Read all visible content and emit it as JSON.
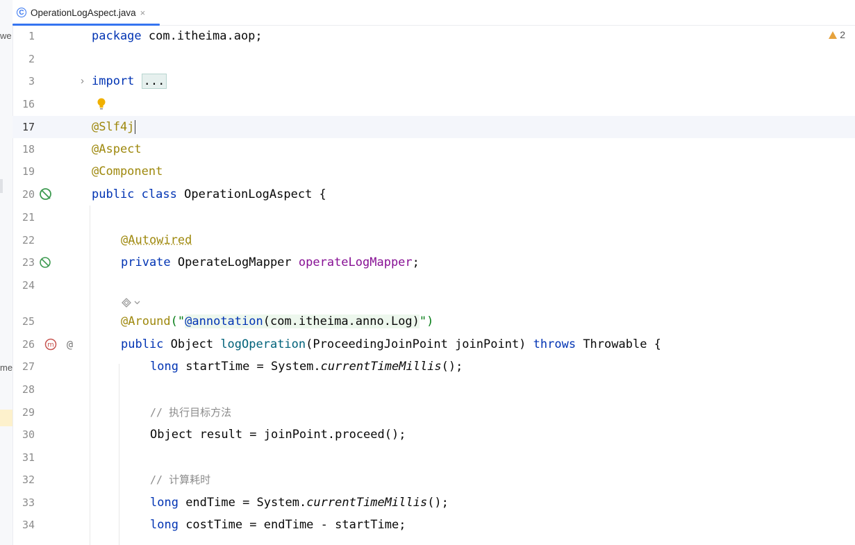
{
  "tab": {
    "title": "OperationLogAspect.java",
    "close": "×",
    "icon_letter": "C",
    "accent": "#3574f0"
  },
  "warnings": {
    "count": "2"
  },
  "left_strip": {
    "text1": "we",
    "text2": "me"
  },
  "lines": [
    {
      "n": "1",
      "code": "package com.itheima.aop;"
    },
    {
      "n": "2",
      "code": ""
    },
    {
      "n": "3",
      "code": "import ..."
    },
    {
      "n": "16",
      "code": ""
    },
    {
      "n": "17",
      "code": "@Slf4j"
    },
    {
      "n": "18",
      "code": "@Aspect"
    },
    {
      "n": "19",
      "code": "@Component"
    },
    {
      "n": "20",
      "code": "public class OperationLogAspect {"
    },
    {
      "n": "21",
      "code": ""
    },
    {
      "n": "22",
      "code": "@Autowired"
    },
    {
      "n": "23",
      "code": "private OperateLogMapper operateLogMapper;"
    },
    {
      "n": "24",
      "code": ""
    },
    {
      "n": "25",
      "code": "@Around(\"@annotation(com.itheima.anno.Log)\")"
    },
    {
      "n": "26",
      "code": "public Object logOperation(ProceedingJoinPoint joinPoint) throws Throwable {"
    },
    {
      "n": "27",
      "code": "long startTime = System.currentTimeMillis();"
    },
    {
      "n": "28",
      "code": ""
    },
    {
      "n": "29",
      "code": "// 执行目标方法"
    },
    {
      "n": "30",
      "code": "Object result = joinPoint.proceed();"
    },
    {
      "n": "31",
      "code": ""
    },
    {
      "n": "32",
      "code": "// 计算耗时"
    },
    {
      "n": "33",
      "code": "long endTime = System.currentTimeMillis();"
    },
    {
      "n": "34",
      "code": "long costTime = endTime - startTime;"
    }
  ],
  "tokens": {
    "pkg_kw": "package",
    "pkg_name": " com.itheima.aop;",
    "import_kw": "import",
    "import_dots": "...",
    "slf4j": "@Slf4j",
    "aspect": "@Aspect",
    "component": "@Component",
    "public": "public",
    "class": "class",
    "class_name": " OperationLogAspect {",
    "autowired": "@Autowired",
    "private": "private",
    "mapper_type": " OperateLogMapper ",
    "mapper_field": "operateLogMapper",
    "semi": ";",
    "around": "@Around",
    "around_open": "(\"",
    "around_ann": "@annotation",
    "around_rest": "(com.itheima.anno.Log)",
    "around_close": "\")",
    "object": " Object ",
    "method": "logOperation",
    "params": "(ProceedingJoinPoint joinPoint) ",
    "throws": "throws",
    "throwable": " Throwable {",
    "long": "long",
    "start_decl": " startTime = System.",
    "ctm": "currentTimeMillis",
    "paren_semi": "();",
    "cmt1": "// 执行目标方法",
    "obj_result": "Object result = joinPoint.proceed();",
    "cmt2": "// 计算耗时",
    "end_decl": " endTime = System.",
    "cost_decl": " costTime = endTime - startTime;"
  }
}
